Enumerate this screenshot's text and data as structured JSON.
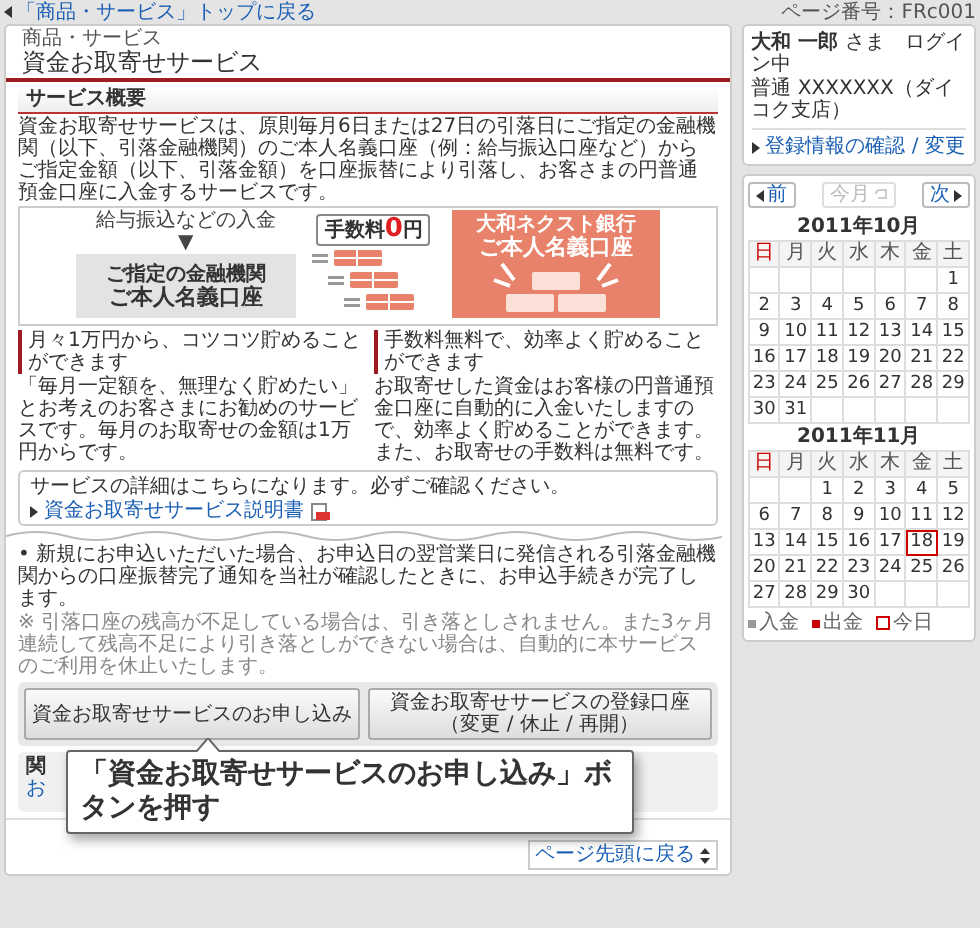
{
  "back_link": "「商品・サービス」トップに戻る",
  "page_number": "ページ番号：FRc001",
  "header": {
    "category": "商品・サービス",
    "title": "資金お取寄せサービス"
  },
  "section_title": "サービス概要",
  "intro": "資金お取寄せサービスは、原則毎月6日または27日の引落日にご指定の金融機関（以下、引落金融機関）のご本人名義口座（例：給与振込口座など）からご指定金額（以下、引落金額）を口座振替により引落し、お客さまの円普通預金口座に入金するサービスです。",
  "diagram": {
    "deposit_label": "給与振込などの入金",
    "arrow": "▼",
    "source_bank": "ご指定の金融機関",
    "source_account": "ご本人名義口座",
    "fee": {
      "label": "手数料",
      "amount": "0",
      "unit": "円"
    },
    "target_bank": "大和ネクスト銀行",
    "target_account": "ご本人名義口座"
  },
  "features": [
    {
      "title": "月々1万円から、コツコツ貯めることができます",
      "text": "「毎月一定額を、無理なく貯めたい」とお考えのお客さまにお勧めのサービスです。毎月のお取寄せの金額は1万円からです。"
    },
    {
      "title": "手数料無料で、効率よく貯めることができます",
      "text": "お取寄せした資金はお客様の円普通預金口座に自動的に入金いたしますので、効率よく貯めることができます。また、お取寄せの手数料は無料です。"
    }
  ],
  "detail": {
    "text": "サービスの詳細はこちらになります。必ずご確認ください。",
    "link": "資金お取寄せサービス説明書"
  },
  "notes": [
    {
      "kind": "bullet",
      "text": "• 新規にお申込いただいた場合、お申込日の翌営業日に発信される引落金融機関からの口座振替完了通知を当社が確認したときに、お申込手続きが完了します。"
    },
    {
      "kind": "caution",
      "text": "※ 引落口座の残高が不足している場合は、引き落としされません。また3ヶ月連続して残高不足により引き落としができない場合は、自動的に本サービスのご利用を休止いたします。"
    }
  ],
  "buttons": [
    "資金お取寄せサービスのお申し込み",
    "資金お取寄せサービスの登録口座（変更 / 休止 / 再開）"
  ],
  "related": {
    "title": "関",
    "link": "お"
  },
  "callout": "「資金お取寄せサービスのお申し込み」ボタンを押す",
  "page_top_link": "ページ先頭に戻る",
  "user": {
    "greeting": "**大和 一郎** さま　ログイン中",
    "account": "普通 XXXXXXX（ダイコク支店）",
    "link": "登録情報の確認 / 変更"
  },
  "calendar_nav": [
    {
      "kind": "prev",
      "label": "前",
      "disabled": false
    },
    {
      "kind": "current",
      "label": "今月",
      "disabled": true
    },
    {
      "kind": "next",
      "label": "次",
      "disabled": false
    }
  ],
  "calendars": [
    {
      "title": "2011年10月",
      "weekdays": [
        {
          "label": "日",
          "color": "#cc0000"
        },
        {
          "label": "月",
          "color": "#555555"
        },
        {
          "label": "火",
          "color": "#555555"
        },
        {
          "label": "水",
          "color": "#555555"
        },
        {
          "label": "木",
          "color": "#555555"
        },
        {
          "label": "金",
          "color": "#555555"
        },
        {
          "label": "土",
          "color": "#555555"
        }
      ],
      "weeks": [
        [
          {
            "day": "1",
            "today": false
          }
        ],
        [
          {
            "day": "2",
            "today": false
          },
          {
            "day": "3",
            "today": false
          },
          {
            "day": "4",
            "today": false
          },
          {
            "day": "5",
            "today": false
          },
          {
            "day": "6",
            "today": false
          },
          {
            "day": "7",
            "today": false
          },
          {
            "day": "8",
            "today": false
          }
        ],
        [
          {
            "day": "9",
            "today": false
          },
          {
            "day": "10",
            "today": false
          },
          {
            "day": "11",
            "today": false
          },
          {
            "day": "12",
            "today": false
          },
          {
            "day": "13",
            "today": false
          },
          {
            "day": "14",
            "today": false
          },
          {
            "day": "15",
            "today": false
          }
        ],
        [
          {
            "day": "16",
            "today": false
          },
          {
            "day": "17",
            "today": false
          },
          {
            "day": "18",
            "today": false
          },
          {
            "day": "19",
            "today": false
          },
          {
            "day": "20",
            "today": false
          },
          {
            "day": "21",
            "today": false
          },
          {
            "day": "22",
            "today": false
          }
        ],
        [
          {
            "day": "23",
            "today": false
          },
          {
            "day": "24",
            "today": false
          },
          {
            "day": "25",
            "today": false
          },
          {
            "day": "26",
            "today": false
          },
          {
            "day": "27",
            "today": false
          },
          {
            "day": "28",
            "today": false
          },
          {
            "day": "29",
            "today": false
          }
        ],
        [
          {
            "day": "30",
            "today": false
          },
          {
            "day": "31",
            "today": false
          }
        ]
      ]
    },
    {
      "title": "2011年11月",
      "weekdays": [
        {
          "label": "日",
          "color": "#cc0000"
        },
        {
          "label": "月",
          "color": "#555555"
        },
        {
          "label": "火",
          "color": "#555555"
        },
        {
          "label": "水",
          "color": "#555555"
        },
        {
          "label": "木",
          "color": "#555555"
        },
        {
          "label": "金",
          "color": "#555555"
        },
        {
          "label": "土",
          "color": "#555555"
        }
      ],
      "weeks": [
        [
          {
            "day": "1",
            "today": false
          },
          {
            "day": "2",
            "today": false
          },
          {
            "day": "3",
            "today": false
          },
          {
            "day": "4",
            "today": false
          },
          {
            "day": "5",
            "today": false
          }
        ],
        [
          {
            "day": "6",
            "today": false
          },
          {
            "day": "7",
            "today": false
          },
          {
            "day": "8",
            "today": false
          },
          {
            "day": "9",
            "today": false
          },
          {
            "day": "10",
            "today": false
          },
          {
            "day": "11",
            "today": false
          },
          {
            "day": "12",
            "today": false
          }
        ],
        [
          {
            "day": "13",
            "today": false
          },
          {
            "day": "14",
            "today": false
          },
          {
            "day": "15",
            "today": false
          },
          {
            "day": "16",
            "today": false
          },
          {
            "day": "17",
            "today": false
          },
          {
            "day": "18",
            "today": true
          },
          {
            "day": "19",
            "today": false
          }
        ],
        [
          {
            "day": "20",
            "today": false
          },
          {
            "day": "21",
            "today": false
          },
          {
            "day": "22",
            "today": false
          },
          {
            "day": "23",
            "today": false
          },
          {
            "day": "24",
            "today": false
          },
          {
            "day": "25",
            "today": false
          },
          {
            "day": "26",
            "today": false
          }
        ],
        [
          {
            "day": "27",
            "today": false
          },
          {
            "day": "28",
            "today": false
          },
          {
            "day": "29",
            "today": false
          },
          {
            "day": "30",
            "today": false
          }
        ]
      ]
    }
  ],
  "legend": [
    {
      "kind": "deposit",
      "label": "入金"
    },
    {
      "kind": "withdrawal",
      "label": "出金"
    },
    {
      "kind": "today",
      "label": "今日"
    }
  ]
}
